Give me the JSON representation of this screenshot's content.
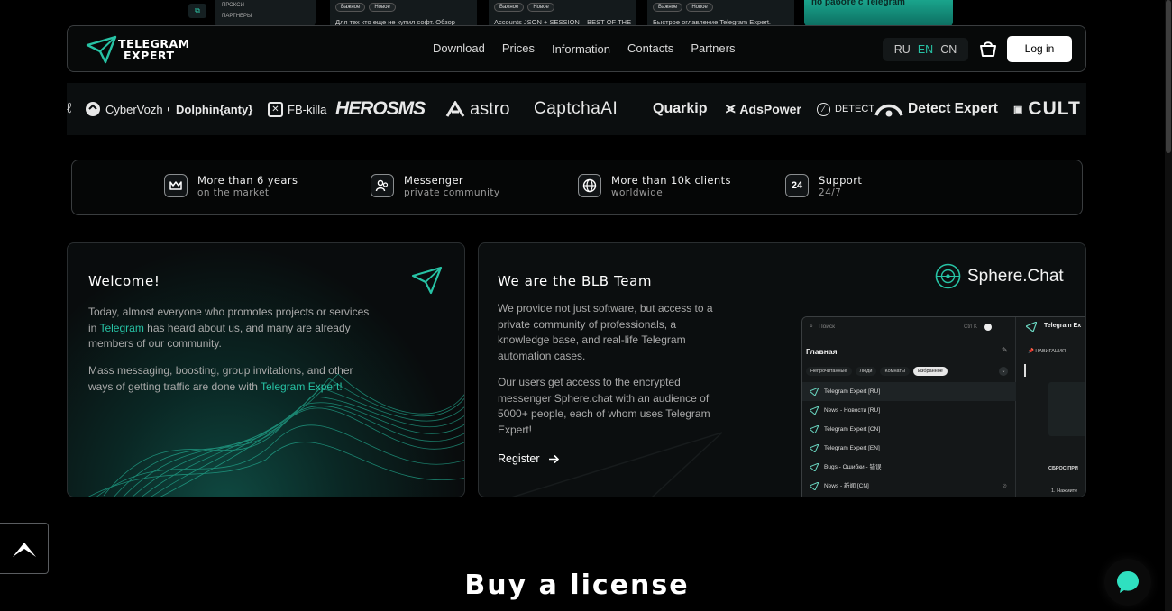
{
  "peek": {
    "side_rows": [
      "ПРОКСИ",
      "ПАРТНЕРЫ"
    ],
    "cards": [
      {
        "chips": [
          "Важное",
          "Новое"
        ],
        "text": "Для тех кто еще не купил софт. Обзор"
      },
      {
        "chips": [
          "Важное",
          "Новое"
        ],
        "text": "Accounts JSON + SESSION – BEST OF THE"
      },
      {
        "chips": [
          "Важное",
          "Новое"
        ],
        "text": "Быстрое оглавление Telegram Expert."
      }
    ],
    "green_text": "по работе с Telegram"
  },
  "header": {
    "logo_line1": "TELEGRAM",
    "logo_line2": "EXPERT",
    "nav": [
      "Download",
      "Prices",
      "Information",
      "Contacts",
      "Partners"
    ],
    "langs": [
      "RU",
      "EN",
      "CN"
    ],
    "active_lang": "EN",
    "login": "Log in"
  },
  "partners": [
    "CyberVozh",
    "Dolphin{anty}",
    "FB-killa",
    "HEROSMS",
    "astro",
    "CaptchaAI",
    "Quarkip",
    "AdsPower",
    "DETECT",
    "Detect Expert",
    "CULT"
  ],
  "stats": [
    {
      "icon": "crown-icon",
      "line1": "More than 6 years",
      "line2": "on the market"
    },
    {
      "icon": "users-icon",
      "line1": "Messenger",
      "line2": "private community"
    },
    {
      "icon": "globe-icon",
      "line1": "More than 10k clients",
      "line2": "worldwide"
    },
    {
      "icon": "support-24-icon",
      "line1": "Support",
      "line2": "24/7"
    }
  ],
  "welcome": {
    "title": "Welcome!",
    "p1_before": "Today, almost everyone who promotes projects or services in ",
    "p1_link": "Telegram",
    "p1_after": " has heard about us, and many are already members of our community.",
    "p2_before": "Mass messaging, boosting, group invitations, and other ways of getting traffic are done with ",
    "p2_link": "Telegram Expert!"
  },
  "blb": {
    "title": "We are the BLB Team",
    "p1": "We provide not just software, but access to a private community of professionals, a knowledge base, and real-life Telegram automation cases.",
    "p2": "Our users get access to the encrypted messenger Sphere.chat with an audience of 5000+ people, each of whom uses Telegram Expert!",
    "register": "Register",
    "sphere": "Sphere.Chat"
  },
  "mock": {
    "search": "Поиск",
    "ctrlk": "Ctrl K",
    "home": "Главная",
    "tabs": [
      "Непрочитанные",
      "Люди",
      "Комнаты",
      "Избранное"
    ],
    "selected_tab": "Избранное",
    "chats": [
      "Telegram Expert [RU]",
      "News - Новости [RU]",
      "Telegram Expert [CN]",
      "Telegram Expert [EN]",
      "Bugs - Ошибки - 错误",
      "News - 新闻 [CN]"
    ],
    "right_title": "Telegram Ex",
    "right_nav": "📌 НАВИГАЦИЯ",
    "right_reset": "СБРОС ПРИ",
    "right_press": "1. Нажмите"
  },
  "buy_title": "Buy a license",
  "colors": {
    "accent": "#27c3a5",
    "bg": "#000000",
    "border": "#3a3d3f"
  }
}
